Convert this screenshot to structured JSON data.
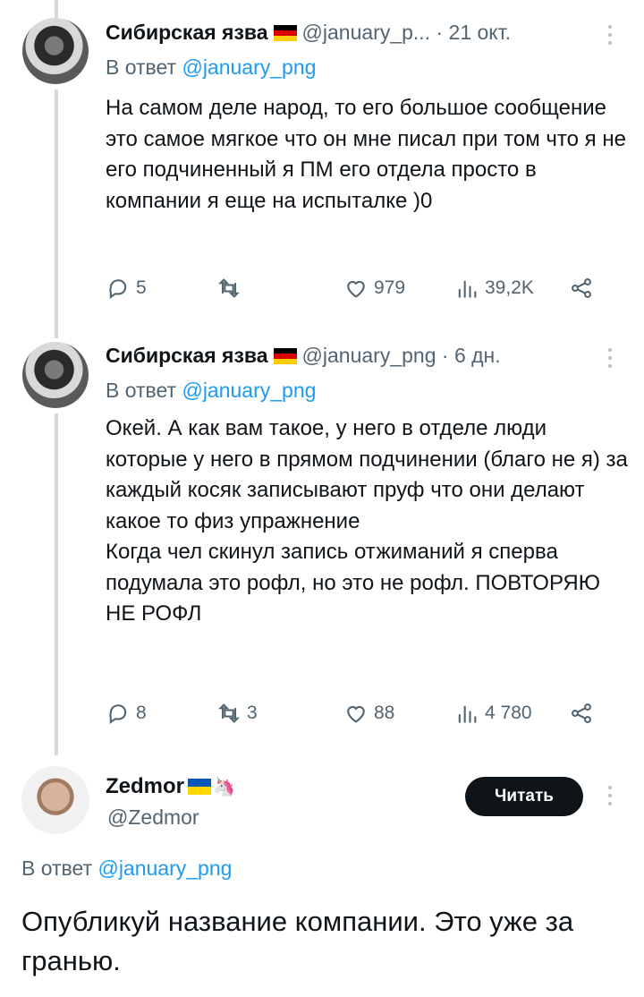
{
  "tweets": [
    {
      "name": "Сибирская язва",
      "handle": "@january_p...",
      "sep": "·",
      "time": "21 окт.",
      "reply_prefix": "В ответ",
      "reply_handle": "@january_png",
      "text": "На самом деле народ, то его большое сообщение это самое мягкое что он мне писал при том что я не его подчиненный я ПМ его отдела просто в компании я еще на испыталке )0",
      "replies": "5",
      "retweets": "",
      "likes": "979",
      "views": "39,2K"
    },
    {
      "name": "Сибирская язва",
      "handle": "@january_png",
      "sep": "·",
      "time": "6 дн.",
      "reply_prefix": "В ответ",
      "reply_handle": "@january_png",
      "text": "Окей. А как вам такое, у него в отделе люди которые у него в прямом подчинении (благо не я) за каждый косяк записывают пруф что они делают какое то физ упражнение\nКогда чел скинул запись отжиманий я сперва подумала это рофл, но это не рофл. ПОВТОРЯЮ НЕ РОФЛ",
      "replies": "8",
      "retweets": "3",
      "likes": "88",
      "views": "4 780"
    }
  ],
  "main_tweet": {
    "name": "Zedmor",
    "name_emoji": "🦄",
    "handle": "@Zedmor",
    "follow_label": "Читать",
    "reply_prefix": "В ответ",
    "reply_handle": "@january_png",
    "text": "Опубликуй название компании. Это уже за гранью."
  },
  "colors": {
    "link": "#1d9bf0",
    "muted": "#536471",
    "thread_line": "#cfd9de"
  },
  "icons": [
    "comment-icon",
    "retweet-icon",
    "heart-icon",
    "views-icon",
    "share-icon",
    "more-icon",
    "flag-germany-icon",
    "flag-ukraine-icon",
    "unicorn-icon"
  ]
}
